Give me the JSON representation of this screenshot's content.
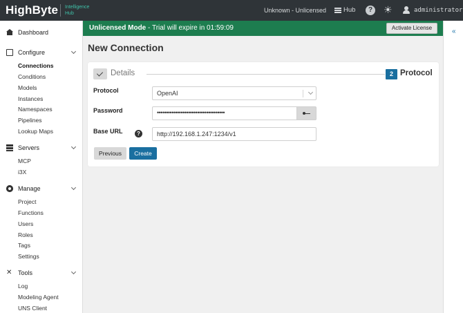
{
  "topbar": {
    "logo": "HighByte",
    "logo_sub_1": "Intelligence",
    "logo_sub_2": "Hub",
    "license_status": "Unknown - Unlicensed",
    "hub_label": "Hub",
    "help_glyph": "?",
    "theme_glyph": "☀",
    "username": "administrator"
  },
  "sidebar": {
    "dashboard": "Dashboard",
    "configure": {
      "label": "Configure",
      "items": [
        "Connections",
        "Conditions",
        "Models",
        "Instances",
        "Namespaces",
        "Pipelines",
        "Lookup Maps"
      ]
    },
    "servers": {
      "label": "Servers",
      "items": [
        "MCP",
        "i3X"
      ]
    },
    "manage": {
      "label": "Manage",
      "items": [
        "Project",
        "Functions",
        "Users",
        "Roles",
        "Tags",
        "Settings"
      ]
    },
    "tools": {
      "label": "Tools",
      "items": [
        "Log",
        "Modeling Agent",
        "UNS Client"
      ]
    },
    "active_item": "Connections"
  },
  "banner": {
    "mode": "Unlicensed Mode",
    "message": " - Trial will expire in 01:59:09",
    "activate_label": "Activate License",
    "color": "#1d7d4f"
  },
  "collapse_glyph": "«",
  "page": {
    "title": "New Connection"
  },
  "steps": {
    "step1_label": "Details",
    "step2_number": "2",
    "step2_label": "Protocol"
  },
  "form": {
    "protocol_label": "Protocol",
    "protocol_value": "OpenAI",
    "password_label": "Password",
    "password_value": "•••••••••••••••••••••••••••••••••••••",
    "base_url_label": "Base URL",
    "base_url_help": "?",
    "base_url_value": "http://192.168.1.247:1234/v1"
  },
  "buttons": {
    "previous": "Previous",
    "create": "Create"
  },
  "colors": {
    "accent": "#1a6fa0",
    "topbar": "#2f3438",
    "brand_teal": "#3fc0a8"
  }
}
